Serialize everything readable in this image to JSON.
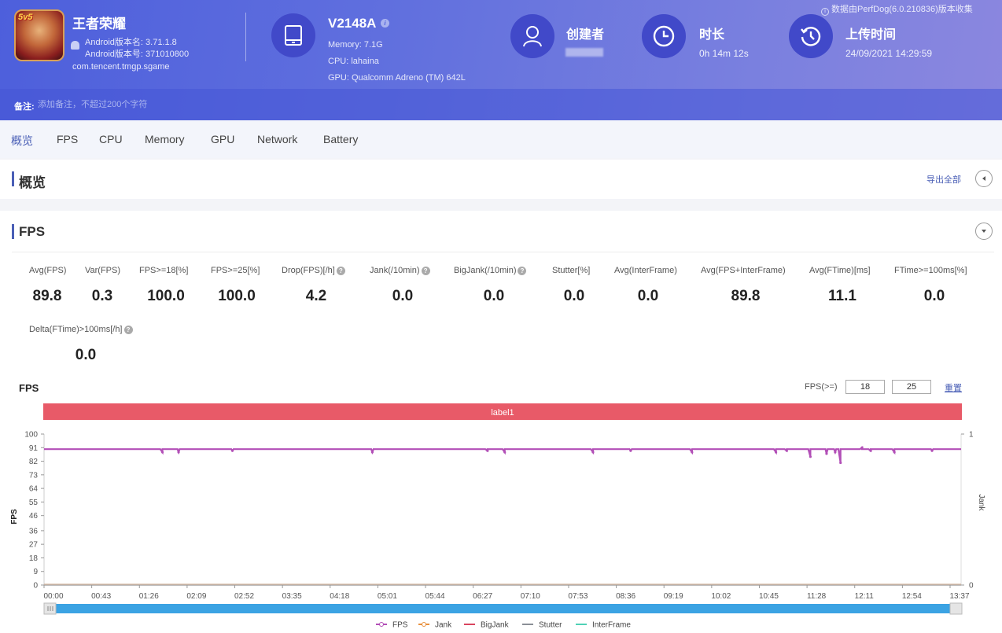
{
  "header": {
    "app": {
      "icon_badge": "5v5",
      "name": "王者荣耀",
      "version_name": "Android版本名: 3.71.1.8",
      "version_code": "Android版本号: 371010800",
      "package": "com.tencent.tmgp.sgame"
    },
    "device": {
      "model": "V2148A",
      "memory": "Memory: 7.1G",
      "cpu": "CPU: lahaina",
      "gpu": "GPU: Qualcomm Adreno (TM) 642L"
    },
    "creator": {
      "title": "创建者",
      "value": ""
    },
    "duration": {
      "title": "时长",
      "value": "0h 14m 12s"
    },
    "upload": {
      "title": "上传时间",
      "value": "24/09/2021 14:29:59"
    },
    "perfdog_note": "数据由PerfDog(6.0.210836)版本收集",
    "remark": {
      "label": "备注:",
      "placeholder": "添加备注，不超过200个字符"
    }
  },
  "tabs": [
    {
      "label": "概览",
      "active": true
    },
    {
      "label": "FPS"
    },
    {
      "label": "CPU"
    },
    {
      "label": "Memory"
    },
    {
      "label": "GPU"
    },
    {
      "label": "Network"
    },
    {
      "label": "Battery"
    }
  ],
  "overview": {
    "title": "概览",
    "export_label": "导出全部"
  },
  "fps_section": {
    "title": "FPS",
    "metrics": [
      {
        "label": "Avg(FPS)",
        "value": "89.8"
      },
      {
        "label": "Var(FPS)",
        "value": "0.3"
      },
      {
        "label": "FPS>=18[%]",
        "value": "100.0"
      },
      {
        "label": "FPS>=25[%]",
        "value": "100.0"
      },
      {
        "label": "Drop(FPS)[/h]",
        "value": "4.2",
        "help": true
      },
      {
        "label": "Jank(/10min)",
        "value": "0.0",
        "help": true
      },
      {
        "label": "BigJank(/10min)",
        "value": "0.0",
        "help": true
      },
      {
        "label": "Stutter[%]",
        "value": "0.0"
      },
      {
        "label": "Avg(InterFrame)",
        "value": "0.0"
      },
      {
        "label": "Avg(FPS+InterFrame)",
        "value": "89.8"
      },
      {
        "label": "Avg(FTime)[ms]",
        "value": "11.1"
      },
      {
        "label": "FTime>=100ms[%]",
        "value": "0.0"
      },
      {
        "label": "Delta(FTime)>100ms[/h]",
        "value": "0.0",
        "help": true
      }
    ],
    "threshold": {
      "label": "FPS(>=)",
      "low": "18",
      "high": "25",
      "reset_label": "重置"
    }
  },
  "chart_data": {
    "type": "line",
    "title": "FPS",
    "label_band": "label1",
    "ylabel": "FPS",
    "y2label": "Jank",
    "ylim": [
      0,
      100
    ],
    "y2lim": [
      0,
      1
    ],
    "yticks": [
      0,
      9,
      18,
      27,
      36,
      46,
      55,
      64,
      73,
      82,
      91,
      100
    ],
    "y2ticks": [
      0,
      1
    ],
    "xticks": [
      "00:00",
      "00:43",
      "01:26",
      "02:09",
      "02:52",
      "03:35",
      "04:18",
      "05:01",
      "05:44",
      "06:27",
      "07:10",
      "07:53",
      "08:36",
      "09:19",
      "10:02",
      "10:45",
      "11:28",
      "12:11",
      "12:54",
      "13:37"
    ],
    "x_duration_seconds": 852,
    "grid": false,
    "legend_position": "bottom",
    "series": [
      {
        "name": "FPS",
        "color": "#b24fb7",
        "baseline": 90,
        "dips": [
          {
            "t": 110,
            "v": 88
          },
          {
            "t": 125,
            "v": 88
          },
          {
            "t": 175,
            "v": 89
          },
          {
            "t": 305,
            "v": 88
          },
          {
            "t": 412,
            "v": 89
          },
          {
            "t": 428,
            "v": 88
          },
          {
            "t": 510,
            "v": 88
          },
          {
            "t": 545,
            "v": 89
          },
          {
            "t": 602,
            "v": 88
          },
          {
            "t": 690,
            "v": 89
          },
          {
            "t": 735,
            "v": 88
          },
          {
            "t": 825,
            "v": 89
          },
          {
            "t": 680,
            "v": 88
          },
          {
            "t": 712,
            "v": 85
          },
          {
            "t": 727,
            "v": 87
          },
          {
            "t": 740,
            "v": 81
          },
          {
            "t": 760,
            "v": 91
          },
          {
            "t": 768,
            "v": 89
          },
          {
            "t": 790,
            "v": 88
          }
        ]
      },
      {
        "name": "Jank",
        "color": "#e8913f"
      },
      {
        "name": "BigJank",
        "color": "#d9455f"
      },
      {
        "name": "Stutter",
        "color": "#8a8f96"
      },
      {
        "name": "InterFrame",
        "color": "#4fd1b6"
      }
    ],
    "zoom_range": [
      0,
      1
    ]
  }
}
